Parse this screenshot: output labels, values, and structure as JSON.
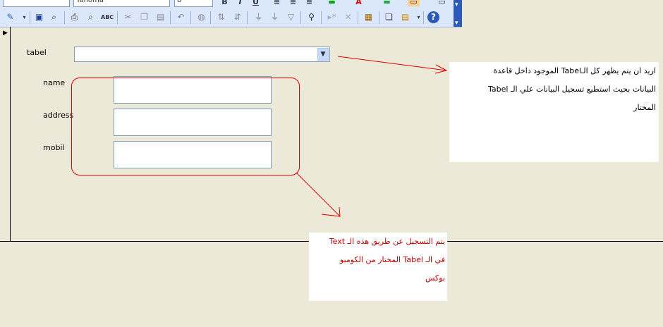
{
  "toolbar": {
    "font_name": "Tahoma",
    "font_size": "8"
  },
  "form": {
    "labels": {
      "tabel": "tabel",
      "name": "name",
      "address": "address",
      "mobil": "mobil"
    },
    "combo_value": "",
    "name_value": "",
    "address_value": "",
    "mobil_value": ""
  },
  "notes": {
    "note1_lines": [
      "اريد ان يتم يظهر كل الـTabel الموجود داخل قاعدة",
      "البيانات بحيث استطيع تسجيل البيانات علي الـ Tabel",
      "المختار"
    ],
    "note2_lines": [
      "يتم التسجيل عن طريق هذه الـ Text",
      "في الـ Tabel  المختار من الكومبو",
      "بوكس"
    ]
  },
  "colors": {
    "annotation": "#e00000",
    "note2_text": "#c00000",
    "form_background": "#ece9d8",
    "toolbar_background": "#dbe8fb"
  }
}
